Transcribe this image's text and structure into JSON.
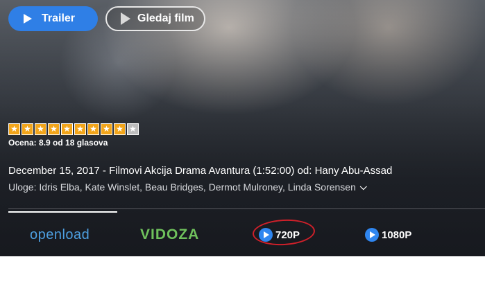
{
  "buttons": {
    "trailer": "Trailer",
    "watch": "Gledaj film"
  },
  "rating": {
    "stars_filled": 9,
    "stars_total": 10,
    "text": "Ocena: 8.9 od 18 glasova"
  },
  "info": {
    "line": "December 15, 2017 - Filmovi Akcija Drama Avantura (1:52:00) od: Hany Abu-Assad",
    "cast": "Uloge: Idris Elba, Kate Winslet, Beau Bridges, Dermot Mulroney, Linda Sorensen"
  },
  "sources": {
    "openload": "openload",
    "vidoza": "VIDOZA",
    "q720": "720P",
    "q1080": "1080P"
  },
  "colors": {
    "accent": "#2f7fe6",
    "star": "#f2a51a",
    "vidoza": "#6fc15c",
    "openload": "#4d9fe0",
    "highlight": "#d0202a"
  },
  "icons": {
    "play": "play-icon",
    "chevron": "chevron-down-icon",
    "star": "star-icon"
  }
}
